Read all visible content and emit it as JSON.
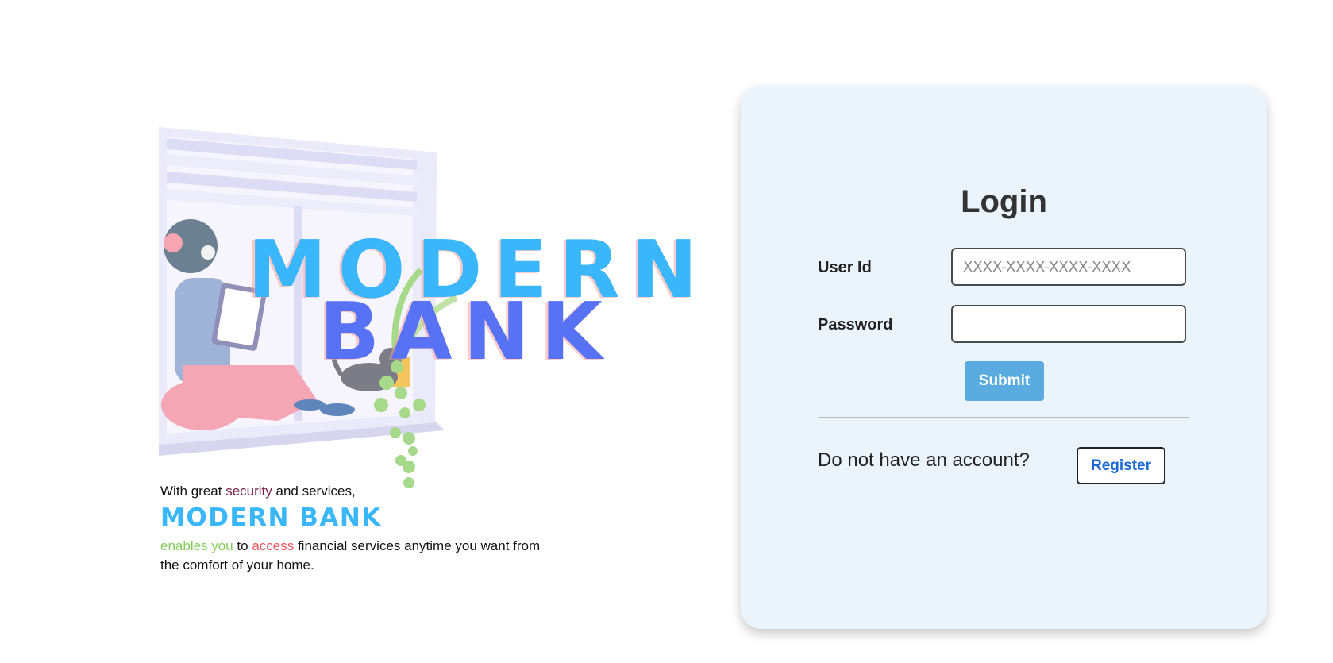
{
  "hero": {
    "brand_line1": "MODERN",
    "brand_line2": "BANK",
    "tagline": {
      "line1_pre": "With great ",
      "line1_highlight": "security",
      "line1_post": " and services,",
      "brand": "MODERN BANK",
      "line3_green": "enables you",
      "line3_to": " to ",
      "line3_red": "access",
      "line3_rest": " financial services anytime you want from the comfort of your home."
    }
  },
  "login": {
    "title": "Login",
    "user_id_label": "User Id",
    "user_id_placeholder": "XXXX-XXXX-XXXX-XXXX",
    "user_id_value": "",
    "password_label": "Password",
    "password_value": "",
    "submit_label": "Submit",
    "no_account_text": "Do not have an account?",
    "register_label": "Register"
  },
  "colors": {
    "brand_blue": "#3ab6fa",
    "brand_indigo": "#5872f6",
    "card_background": "#ebf3fb",
    "submit_blue": "#5aabe0",
    "register_text": "#1d6ad6"
  }
}
